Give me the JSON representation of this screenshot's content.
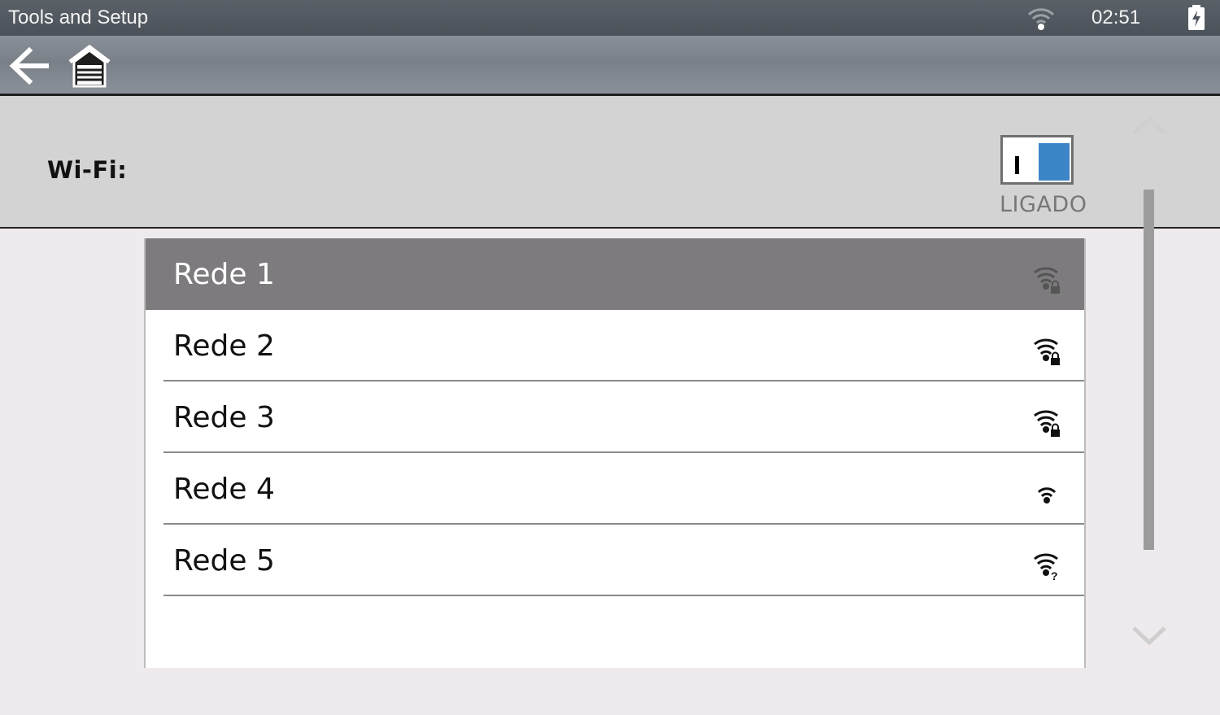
{
  "status_bar": {
    "app_title": "Tools and Setup",
    "time": "02:51",
    "wifi_icon": "wifi-icon",
    "battery_icon": "battery-charging-icon"
  },
  "toolbar": {
    "back_icon": "back-arrow-icon",
    "home_icon": "home-icon"
  },
  "wifi": {
    "label": "Wi-Fi:",
    "toggle_state": "LIGADO",
    "toggle_on": true,
    "accent_color": "#3c85c8"
  },
  "networks": [
    {
      "name": "Rede 1",
      "icon": "wifi-locked-icon",
      "selected": true
    },
    {
      "name": "Rede 2",
      "icon": "wifi-locked-icon",
      "selected": false
    },
    {
      "name": "Rede 3",
      "icon": "wifi-locked-icon",
      "selected": false
    },
    {
      "name": "Rede 4",
      "icon": "wifi-icon",
      "selected": false
    },
    {
      "name": "Rede 5",
      "icon": "wifi-unknown-icon",
      "selected": false
    }
  ],
  "scroll": {
    "up_icon": "chevron-up-icon",
    "down_icon": "chevron-down-icon"
  }
}
